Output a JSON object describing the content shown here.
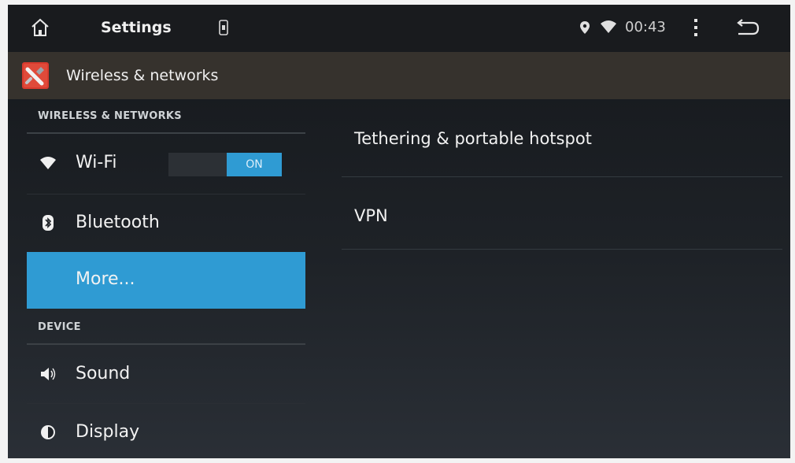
{
  "status_bar": {
    "title": "Settings",
    "clock": "00:43",
    "icons": [
      "home-icon",
      "sim-icon",
      "location-icon",
      "wifi-signal-icon",
      "overflow-menu-icon",
      "back-icon"
    ]
  },
  "action_bar": {
    "title": "Wireless & networks",
    "icon": "settings-app-icon"
  },
  "left_pane": {
    "sections": [
      {
        "header": "WIRELESS & NETWORKS",
        "items": [
          {
            "label": "Wi-Fi",
            "icon": "wifi-icon",
            "toggle": "ON"
          },
          {
            "label": "Bluetooth",
            "icon": "bluetooth-icon"
          },
          {
            "label": "More...",
            "selected": true
          }
        ]
      },
      {
        "header": "DEVICE",
        "items": [
          {
            "label": "Sound",
            "icon": "speaker-icon"
          },
          {
            "label": "Display",
            "icon": "brightness-icon"
          }
        ]
      }
    ]
  },
  "right_pane": {
    "items": [
      {
        "label": "Tethering & portable hotspot"
      },
      {
        "label": "VPN"
      }
    ]
  },
  "colors": {
    "accent": "#2f9bd3",
    "action_bar": "#36322d",
    "status_bar": "#191b1e"
  }
}
